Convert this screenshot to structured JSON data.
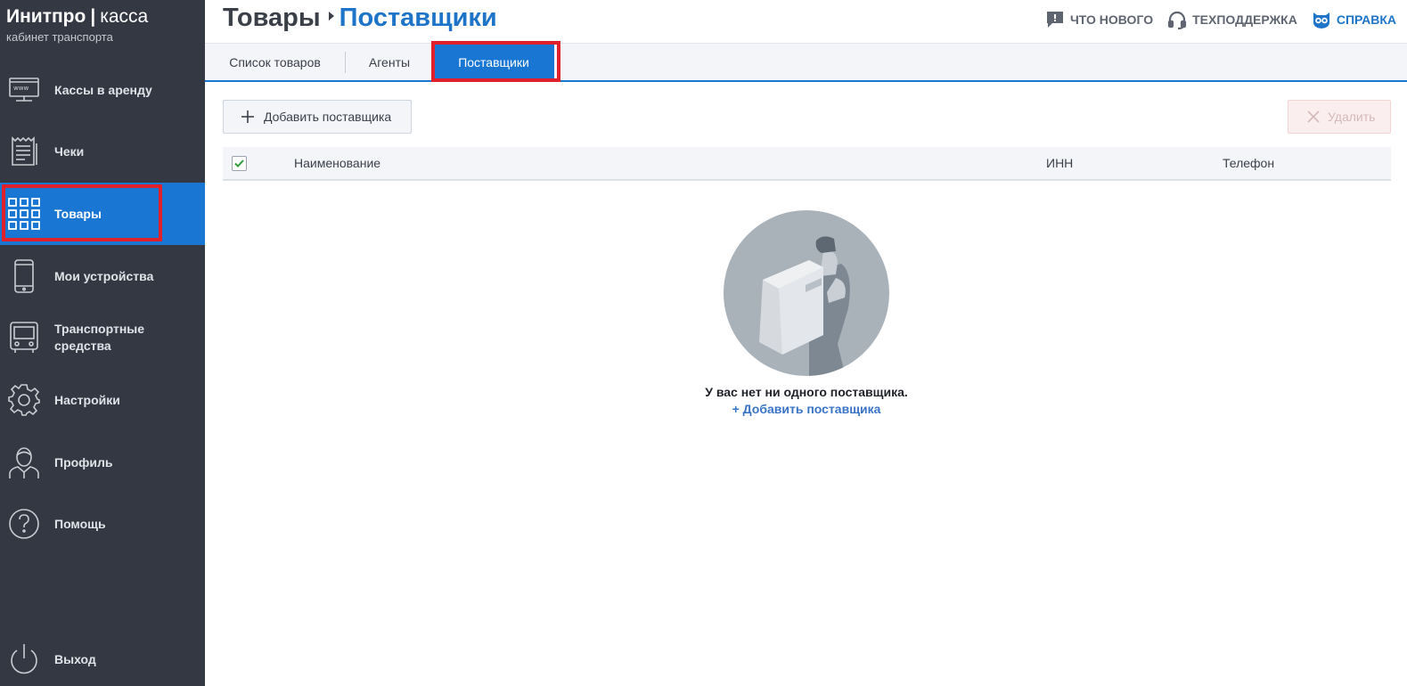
{
  "brand": {
    "name": "Инитпро",
    "separator": "|",
    "product": "касса",
    "subtitle": "кабинет транспорта"
  },
  "sidebar": {
    "items": [
      {
        "label": "Кассы в аренду",
        "icon": "web-terminal-icon"
      },
      {
        "label": "Чеки",
        "icon": "receipt-icon"
      },
      {
        "label": "Товары",
        "icon": "grid-icon",
        "active": true
      },
      {
        "label": "Мои устройства",
        "icon": "phone-icon"
      },
      {
        "label": "Транспортные средства",
        "icon": "bus-icon"
      },
      {
        "label": "Настройки",
        "icon": "gear-icon"
      },
      {
        "label": "Профиль",
        "icon": "user-icon"
      },
      {
        "label": "Помощь",
        "icon": "question-icon"
      }
    ],
    "logout": {
      "label": "Выход",
      "icon": "power-icon"
    }
  },
  "header": {
    "breadcrumb_parent": "Товары",
    "breadcrumb_current": "Поставщики",
    "links": {
      "whats_new": "ЧТО НОВОГО",
      "support": "ТЕХПОДДЕРЖКА",
      "help": "СПРАВКА"
    }
  },
  "tabs": [
    {
      "label": "Список товаров"
    },
    {
      "label": "Агенты"
    },
    {
      "label": "Поставщики",
      "active": true
    }
  ],
  "toolbar": {
    "add_label": "Добавить поставщика",
    "delete_label": "Удалить"
  },
  "table": {
    "columns": [
      "Наименование",
      "ИНН",
      "Телефон"
    ],
    "select_all_checked": true,
    "rows": []
  },
  "empty_state": {
    "message": "У вас нет ни одного поставщика.",
    "action": "+ Добавить поставщика"
  },
  "colors": {
    "sidebar_bg": "#343843",
    "accent": "#1a76d3",
    "highlight": "#e0202a"
  }
}
